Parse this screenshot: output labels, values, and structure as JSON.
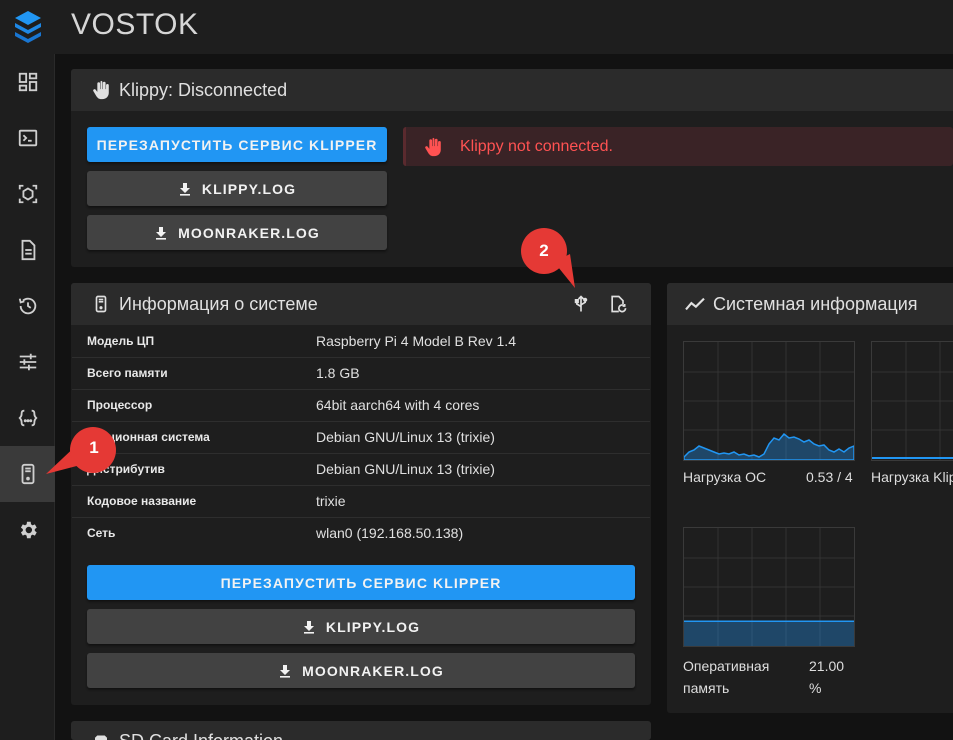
{
  "app": {
    "title": "VOSTOK"
  },
  "sidebar": {
    "items": [
      {
        "icon": "dashboard-icon"
      },
      {
        "icon": "console-icon"
      },
      {
        "icon": "webcam-icon"
      },
      {
        "icon": "file-icon"
      },
      {
        "icon": "history-icon"
      },
      {
        "icon": "tune-icon"
      },
      {
        "icon": "config-icon"
      },
      {
        "icon": "machine-icon",
        "active": true
      },
      {
        "icon": "gear-icon"
      }
    ]
  },
  "klippy_panel": {
    "title": "Klippy: Disconnected",
    "restart_label": "ПЕРЕЗАПУСТИТЬ СЕРВИС KLIPPER",
    "klippy_log_label": "KLIPPY.LOG",
    "moonraker_log_label": "MOONRAKER.LOG",
    "alert_text": "Klippy not connected."
  },
  "system_panel": {
    "title": "Информация о системе",
    "rows": [
      {
        "key": "Модель ЦП",
        "value": "Raspberry Pi 4 Model B Rev 1.4"
      },
      {
        "key": "Всего памяти",
        "value": "1.8 GB"
      },
      {
        "key": "Процессор",
        "value": "64bit aarch64 with 4 cores"
      },
      {
        "key": "ерационная система",
        "value": "Debian GNU/Linux 13 (trixie)"
      },
      {
        "key": "Дистрибутив",
        "value": "Debian GNU/Linux 13 (trixie)"
      },
      {
        "key": "Кодовое название",
        "value": "trixie"
      },
      {
        "key": "Сеть",
        "value": "wlan0 (192.168.50.138)"
      }
    ],
    "restart_label": "ПЕРЕЗАПУСТИТЬ СЕРВИС KLIPPER",
    "klippy_log_label": "KLIPPY.LOG",
    "moonraker_log_label": "MOONRAKER.LOG"
  },
  "sysinfo_panel": {
    "title": "Системная информация",
    "load_label": "Нагрузка ОС",
    "load_value": "0.53 / 4",
    "klipper_load_label": "Нагрузка Klip",
    "ram_label_1": "Оперативная",
    "ram_label_2": "память",
    "ram_value_1": "21.00",
    "ram_value_2": "%",
    "ram_fraction": 0.21
  },
  "sdcard_panel": {
    "title": "SD Card Information"
  },
  "annotations": {
    "badge_1": "1",
    "badge_2": "2"
  },
  "colors": {
    "primary": "#2196f3",
    "secondary": "#424242",
    "error": "#ff5252",
    "badge": "#e53935"
  }
}
